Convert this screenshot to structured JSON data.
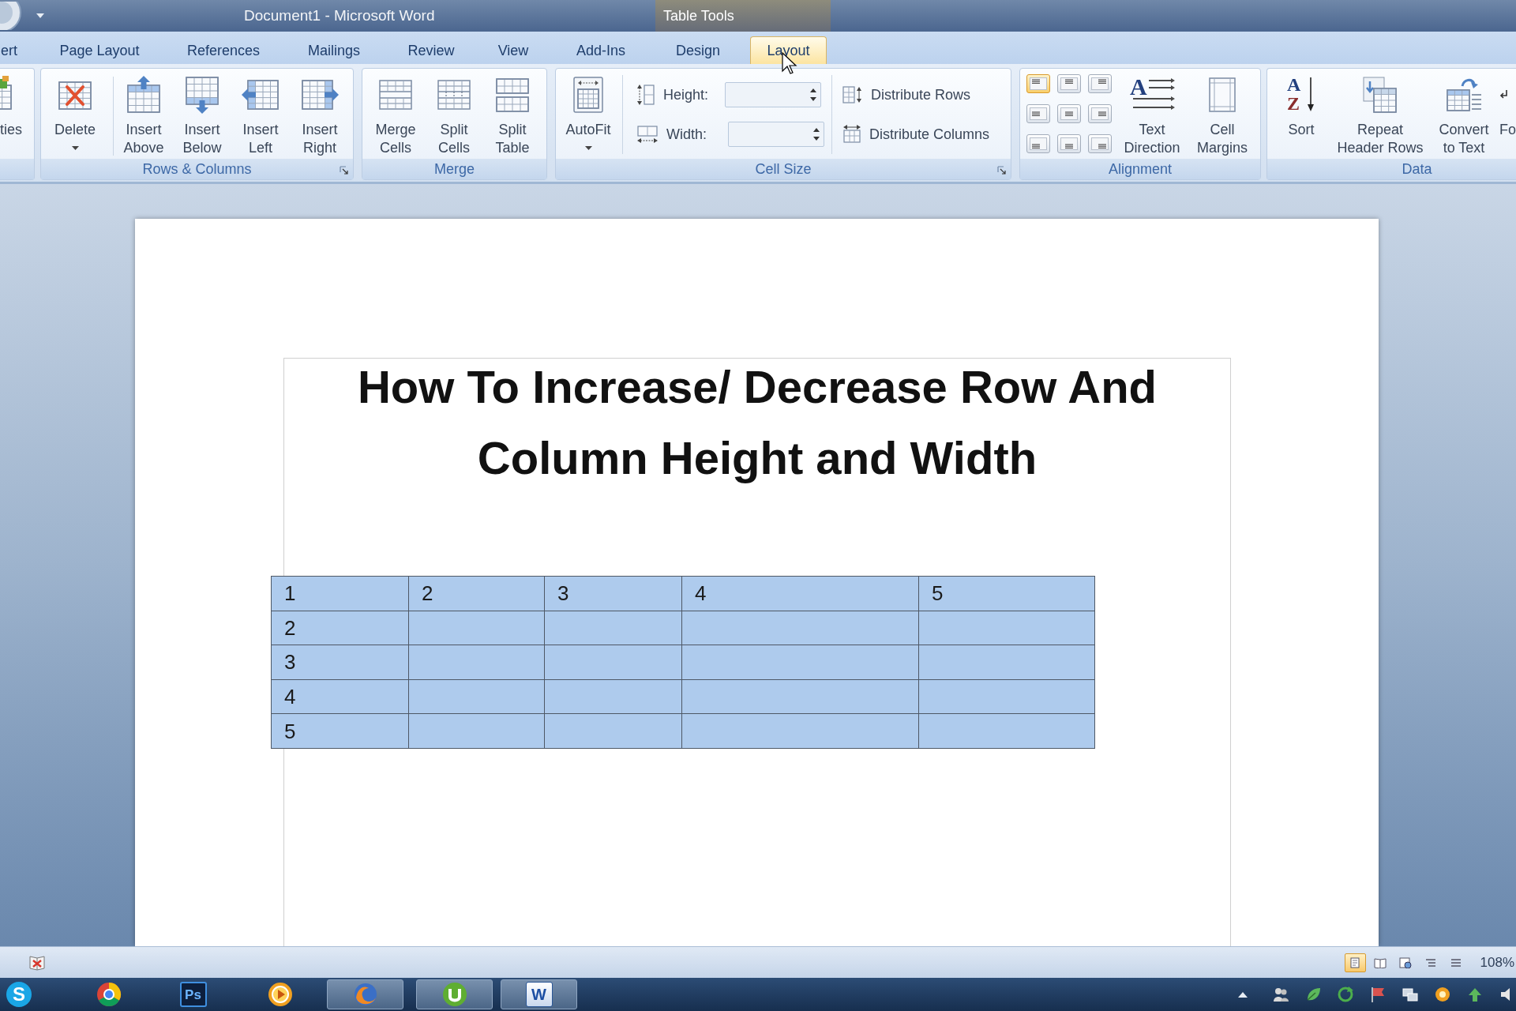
{
  "title_bar": {
    "title": "Document1 - Microsoft Word",
    "context_title": "Table Tools"
  },
  "tabs": [
    {
      "label": "ert",
      "selected": false
    },
    {
      "label": "Page Layout",
      "selected": false
    },
    {
      "label": "References",
      "selected": false
    },
    {
      "label": "Mailings",
      "selected": false
    },
    {
      "label": "Review",
      "selected": false
    },
    {
      "label": "View",
      "selected": false
    },
    {
      "label": "Add-Ins",
      "selected": false
    },
    {
      "label": "Design",
      "selected": false
    },
    {
      "label": "Layout",
      "selected": true
    }
  ],
  "ribbon": {
    "groups": [
      {
        "kind": "buttons",
        "buttons": [
          {
            "kind": "properties",
            "label": [
              "ties"
            ]
          }
        ]
      },
      {
        "kind": "buttons",
        "label": "Rows & Columns",
        "launcher": true,
        "buttons": [
          {
            "kind": "delete",
            "label": [
              "Delete"
            ],
            "dropdown": true
          },
          {
            "kind": "above",
            "label": [
              "Insert",
              "Above"
            ]
          },
          {
            "kind": "below",
            "label": [
              "Insert",
              "Below"
            ]
          },
          {
            "kind": "left",
            "label": [
              "Insert",
              "Left"
            ]
          },
          {
            "kind": "right",
            "label": [
              "Insert",
              "Right"
            ]
          }
        ]
      },
      {
        "kind": "buttons",
        "label": "Merge",
        "buttons": [
          {
            "kind": "merge",
            "label": [
              "Merge",
              "Cells"
            ]
          },
          {
            "kind": "splitcells",
            "label": [
              "Split",
              "Cells"
            ]
          },
          {
            "kind": "splittable",
            "label": [
              "Split",
              "Table"
            ]
          }
        ]
      },
      {
        "kind": "cellsize",
        "label": "Cell Size",
        "launcher": true,
        "buttons": [
          {
            "kind": "autofit",
            "label": [
              "AutoFit"
            ],
            "dropdown": true
          }
        ],
        "fields": [
          {
            "kind": "height",
            "label": "Height:"
          },
          {
            "kind": "width",
            "label": "Width:"
          }
        ],
        "commands": [
          {
            "kind": "rows",
            "label": "Distribute Rows"
          },
          {
            "kind": "columns",
            "label": "Distribute Columns"
          }
        ]
      },
      {
        "kind": "alignment",
        "label": "Alignment",
        "align_buttons": [
          {
            "selected": true
          },
          {
            "selected": false
          },
          {
            "selected": false
          },
          {
            "selected": false
          },
          {
            "selected": false
          },
          {
            "selected": false
          },
          {
            "selected": false
          },
          {
            "selected": false
          },
          {
            "selected": false
          }
        ],
        "buttons": [
          {
            "kind": "textdirection",
            "glyph": "A",
            "label": [
              "Text",
              "Direction"
            ]
          },
          {
            "kind": "margins",
            "label": [
              "Cell",
              "Margins"
            ]
          }
        ]
      },
      {
        "kind": "buttons",
        "label": "Data",
        "buttons": [
          {
            "kind": "sort",
            "glyphs": [
              "A",
              "Z"
            ],
            "label": [
              "Sort"
            ]
          },
          {
            "kind": "repeat",
            "label": [
              "Repeat",
              "Header Rows"
            ]
          },
          {
            "kind": "convert",
            "label": [
              "Convert",
              "to Text"
            ]
          },
          {
            "kind": "formula",
            "label": [
              "Fo"
            ]
          }
        ]
      }
    ]
  },
  "document": {
    "heading": "How To Increase/ Decrease Row And Column Height and Width",
    "table": {
      "selected": true,
      "rows": [
        [
          "1",
          "2",
          "3",
          "4",
          "5"
        ],
        [
          "2"
        ],
        [
          "3"
        ],
        [
          "4"
        ],
        [
          "5"
        ]
      ]
    }
  },
  "status_bar": {
    "views": [
      {
        "selected": true
      },
      {
        "selected": false
      },
      {
        "selected": false
      },
      {
        "selected": false
      },
      {
        "selected": false
      }
    ],
    "zoom": "108%"
  },
  "taskbar": {
    "items": [
      {
        "kind": "badge",
        "glyph": "S",
        "running": false
      },
      {
        "kind": "orb",
        "running": false
      },
      {
        "kind": "tile",
        "glyph": "Ps",
        "running": false
      },
      {
        "kind": "disc",
        "running": false
      },
      {
        "kind": "fox",
        "running": true
      },
      {
        "kind": "leaf",
        "running": true
      },
      {
        "kind": "doc",
        "glyph": "W",
        "running": true
      }
    ]
  }
}
